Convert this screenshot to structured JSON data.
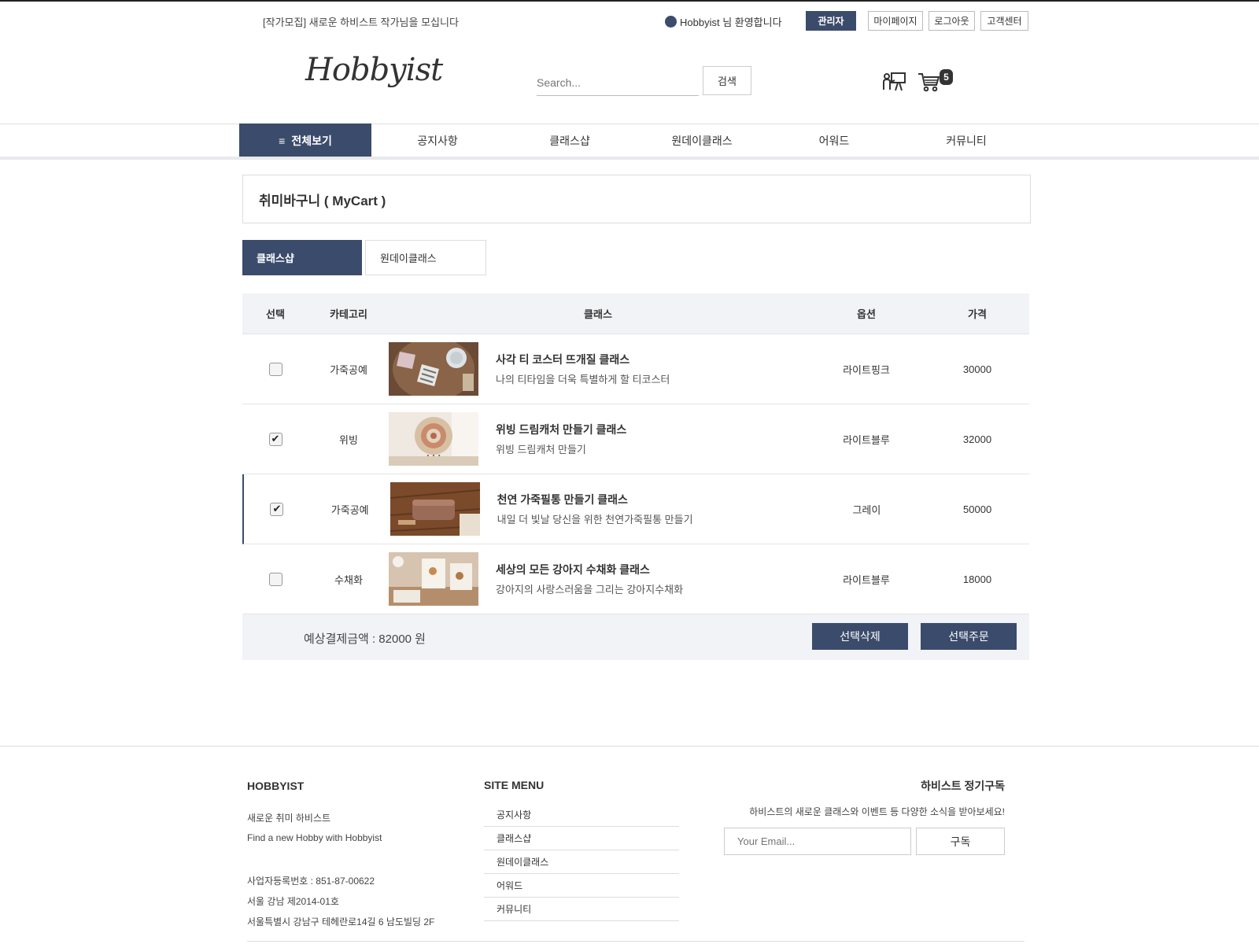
{
  "topbar": {
    "notice": "[작가모집] 새로운 하비스트 작가님을 모십니다",
    "welcome": "Hobbyist 님 환영합니다",
    "buttons": [
      "관리자",
      "마이페이지",
      "로그아웃",
      "고객센터"
    ]
  },
  "header": {
    "logo": "Hobbyist",
    "search_placeholder": "Search...",
    "search_button": "검색",
    "cart_count": "5",
    "icons": [
      "class-icon",
      "cart-icon"
    ]
  },
  "nav": {
    "all_label": "전체보기",
    "items": [
      "공지사항",
      "클래스샵",
      "원데이클래스",
      "어워드",
      "커뮤니티"
    ]
  },
  "page": {
    "title": "취미바구니 ( MyCart )"
  },
  "tabs": [
    "클래스샵",
    "원데이클래스"
  ],
  "table": {
    "headers": [
      "선택",
      "카테고리",
      "클래스",
      "옵션",
      "가격"
    ],
    "rows": [
      {
        "checked": false,
        "category": "가죽공예",
        "name": "사각 티 코스터 뜨개질 클래스",
        "desc": "나의 티타임을 더욱 특별하게 할 티코스터",
        "option": "라이트핑크",
        "price": "30000",
        "thumb": "coaster"
      },
      {
        "checked": true,
        "category": "위빙",
        "name": "위빙 드림캐처 만들기 클래스",
        "desc": "위빙 드림캐처 만들기",
        "option": "라이트블루",
        "price": "32000",
        "thumb": "dreamcatcher"
      },
      {
        "checked": true,
        "category": "가죽공예",
        "name": "천연 가죽필통 만들기 클래스",
        "desc": "내일 더 빛날 당신을 위한 천연가죽필통 만들기",
        "option": "그레이",
        "price": "50000",
        "thumb": "leather"
      },
      {
        "checked": false,
        "category": "수채화",
        "name": "세상의 모든 강아지 수채화 클래스",
        "desc": "강아지의 사랑스러움을 그리는 강아지수채화",
        "option": "라이트블루",
        "price": "18000",
        "thumb": "watercolor"
      }
    ],
    "total": "예상결제금액 : 82000 원",
    "delete_button": "선택삭제",
    "order_button": "선택주문"
  },
  "footer": {
    "brand": "HOBBYIST",
    "tagline_ko": "새로운 취미 하비스트",
    "tagline_en": "Find a new Hobby with Hobbyist",
    "biz_number": "사업자등록번호 : 851-87-00622",
    "biz_reg": "서울 강남 제2014-01호",
    "address": "서울특별시 강남구 테헤란로14길 6 남도빌딩 2F",
    "menu_title": "SITE MENU",
    "menu_items": [
      "공지사항",
      "클래스샵",
      "원데이클래스",
      "어워드",
      "커뮤니티"
    ],
    "subscribe_title": "하비스트 정기구독",
    "subscribe_desc": "하비스트의 새로운 클래스와 이벤트 등 다양한 소식을 받아보세요!",
    "email_placeholder": "Your Email...",
    "subscribe_button": "구독"
  }
}
